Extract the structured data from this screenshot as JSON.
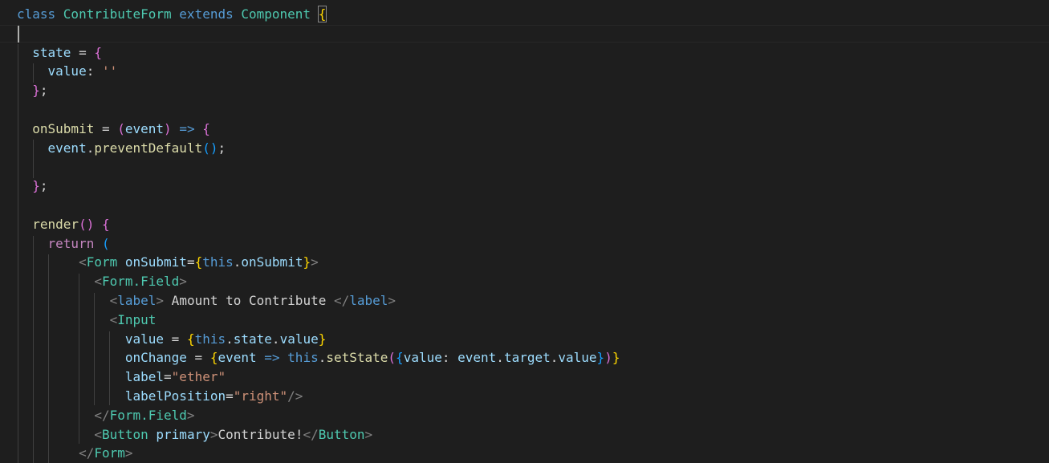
{
  "colors": {
    "background": "#1e1e1e",
    "keyword": "#569cd6",
    "control": "#c586c0",
    "class": "#4ec9b0",
    "variable": "#9cdcfe",
    "function": "#dcdcaa",
    "string": "#ce9178",
    "tag_punct": "#808080",
    "bracket_1": "#ffd700",
    "bracket_2": "#da70d6",
    "bracket_3": "#179fff",
    "text": "#d4d4d4"
  },
  "code_lines": [
    {
      "tokens": [
        {
          "t": "class ",
          "c": "kw"
        },
        {
          "t": "ContributeForm ",
          "c": "cls"
        },
        {
          "t": "extends ",
          "c": "kw"
        },
        {
          "t": "Component ",
          "c": "cls"
        },
        {
          "t": "{",
          "c": "b1 bracket-box"
        }
      ]
    },
    {
      "tokens": []
    },
    {
      "tokens": [
        {
          "t": "  "
        },
        {
          "t": "state",
          "c": "var"
        },
        {
          "t": " = ",
          "c": "pl"
        },
        {
          "t": "{",
          "c": "b2"
        }
      ]
    },
    {
      "tokens": [
        {
          "t": "    "
        },
        {
          "t": "value",
          "c": "var"
        },
        {
          "t": ": ",
          "c": "pl"
        },
        {
          "t": "''",
          "c": "str"
        }
      ]
    },
    {
      "tokens": [
        {
          "t": "  "
        },
        {
          "t": "}",
          "c": "b2"
        },
        {
          "t": ";",
          "c": "pl"
        }
      ]
    },
    {
      "tokens": []
    },
    {
      "tokens": [
        {
          "t": "  "
        },
        {
          "t": "onSubmit",
          "c": "fn"
        },
        {
          "t": " = ",
          "c": "pl"
        },
        {
          "t": "(",
          "c": "b2"
        },
        {
          "t": "event",
          "c": "var"
        },
        {
          "t": ")",
          "c": "b2"
        },
        {
          "t": " => ",
          "c": "kw"
        },
        {
          "t": "{",
          "c": "b2"
        }
      ]
    },
    {
      "tokens": [
        {
          "t": "    "
        },
        {
          "t": "event",
          "c": "var"
        },
        {
          "t": ".",
          "c": "pl"
        },
        {
          "t": "preventDefault",
          "c": "fn"
        },
        {
          "t": "()",
          "c": "b3"
        },
        {
          "t": ";",
          "c": "pl"
        }
      ]
    },
    {
      "tokens": []
    },
    {
      "tokens": [
        {
          "t": "  "
        },
        {
          "t": "}",
          "c": "b2"
        },
        {
          "t": ";",
          "c": "pl"
        }
      ]
    },
    {
      "tokens": []
    },
    {
      "tokens": [
        {
          "t": "  "
        },
        {
          "t": "render",
          "c": "fn"
        },
        {
          "t": "()",
          "c": "b2"
        },
        {
          "t": " ",
          "c": "pl"
        },
        {
          "t": "{",
          "c": "b2"
        }
      ]
    },
    {
      "tokens": [
        {
          "t": "    "
        },
        {
          "t": "return ",
          "c": "ctl"
        },
        {
          "t": "(",
          "c": "b3"
        }
      ]
    },
    {
      "tokens": [
        {
          "t": "        "
        },
        {
          "t": "<",
          "c": "tag"
        },
        {
          "t": "Form ",
          "c": "cls"
        },
        {
          "t": "onSubmit",
          "c": "var"
        },
        {
          "t": "=",
          "c": "pl"
        },
        {
          "t": "{",
          "c": "b1"
        },
        {
          "t": "this",
          "c": "kw"
        },
        {
          "t": ".",
          "c": "pl"
        },
        {
          "t": "onSubmit",
          "c": "var"
        },
        {
          "t": "}",
          "c": "b1"
        },
        {
          "t": ">",
          "c": "tag"
        }
      ]
    },
    {
      "tokens": [
        {
          "t": "          "
        },
        {
          "t": "<",
          "c": "tag"
        },
        {
          "t": "Form.Field",
          "c": "cls"
        },
        {
          "t": ">",
          "c": "tag"
        }
      ]
    },
    {
      "tokens": [
        {
          "t": "            "
        },
        {
          "t": "<",
          "c": "tag"
        },
        {
          "t": "label",
          "c": "kw"
        },
        {
          "t": ">",
          "c": "tag"
        },
        {
          "t": " Amount to Contribute ",
          "c": "pl"
        },
        {
          "t": "</",
          "c": "tag"
        },
        {
          "t": "label",
          "c": "kw"
        },
        {
          "t": ">",
          "c": "tag"
        }
      ]
    },
    {
      "tokens": [
        {
          "t": "            "
        },
        {
          "t": "<",
          "c": "tag"
        },
        {
          "t": "Input",
          "c": "cls"
        }
      ]
    },
    {
      "tokens": [
        {
          "t": "              "
        },
        {
          "t": "value",
          "c": "var"
        },
        {
          "t": " = ",
          "c": "pl"
        },
        {
          "t": "{",
          "c": "b1"
        },
        {
          "t": "this",
          "c": "kw"
        },
        {
          "t": ".",
          "c": "pl"
        },
        {
          "t": "state",
          "c": "var"
        },
        {
          "t": ".",
          "c": "pl"
        },
        {
          "t": "value",
          "c": "var"
        },
        {
          "t": "}",
          "c": "b1"
        }
      ]
    },
    {
      "tokens": [
        {
          "t": "              "
        },
        {
          "t": "onChange",
          "c": "var"
        },
        {
          "t": " = ",
          "c": "pl"
        },
        {
          "t": "{",
          "c": "b1"
        },
        {
          "t": "event",
          "c": "var"
        },
        {
          "t": " => ",
          "c": "kw"
        },
        {
          "t": "this",
          "c": "kw"
        },
        {
          "t": ".",
          "c": "pl"
        },
        {
          "t": "setState",
          "c": "fn"
        },
        {
          "t": "(",
          "c": "b2"
        },
        {
          "t": "{",
          "c": "b3"
        },
        {
          "t": "value",
          "c": "var"
        },
        {
          "t": ": ",
          "c": "pl"
        },
        {
          "t": "event",
          "c": "var"
        },
        {
          "t": ".",
          "c": "pl"
        },
        {
          "t": "target",
          "c": "var"
        },
        {
          "t": ".",
          "c": "pl"
        },
        {
          "t": "value",
          "c": "var"
        },
        {
          "t": "}",
          "c": "b3"
        },
        {
          "t": ")",
          "c": "b2"
        },
        {
          "t": "}",
          "c": "b1"
        }
      ]
    },
    {
      "tokens": [
        {
          "t": "              "
        },
        {
          "t": "label",
          "c": "var"
        },
        {
          "t": "=",
          "c": "pl"
        },
        {
          "t": "\"ether\"",
          "c": "str"
        }
      ]
    },
    {
      "tokens": [
        {
          "t": "              "
        },
        {
          "t": "labelPosition",
          "c": "var"
        },
        {
          "t": "=",
          "c": "pl"
        },
        {
          "t": "\"right\"",
          "c": "str"
        },
        {
          "t": "/>",
          "c": "tag"
        }
      ]
    },
    {
      "tokens": [
        {
          "t": "          "
        },
        {
          "t": "</",
          "c": "tag"
        },
        {
          "t": "Form.Field",
          "c": "cls"
        },
        {
          "t": ">",
          "c": "tag"
        }
      ]
    },
    {
      "tokens": [
        {
          "t": "          "
        },
        {
          "t": "<",
          "c": "tag"
        },
        {
          "t": "Button ",
          "c": "cls"
        },
        {
          "t": "primary",
          "c": "var"
        },
        {
          "t": ">",
          "c": "tag"
        },
        {
          "t": "Contribute!",
          "c": "pl"
        },
        {
          "t": "</",
          "c": "tag"
        },
        {
          "t": "Button",
          "c": "cls"
        },
        {
          "t": ">",
          "c": "tag"
        }
      ]
    },
    {
      "tokens": [
        {
          "t": "        "
        },
        {
          "t": "</",
          "c": "tag"
        },
        {
          "t": "Form",
          "c": "cls"
        },
        {
          "t": ">",
          "c": "tag"
        }
      ]
    }
  ]
}
